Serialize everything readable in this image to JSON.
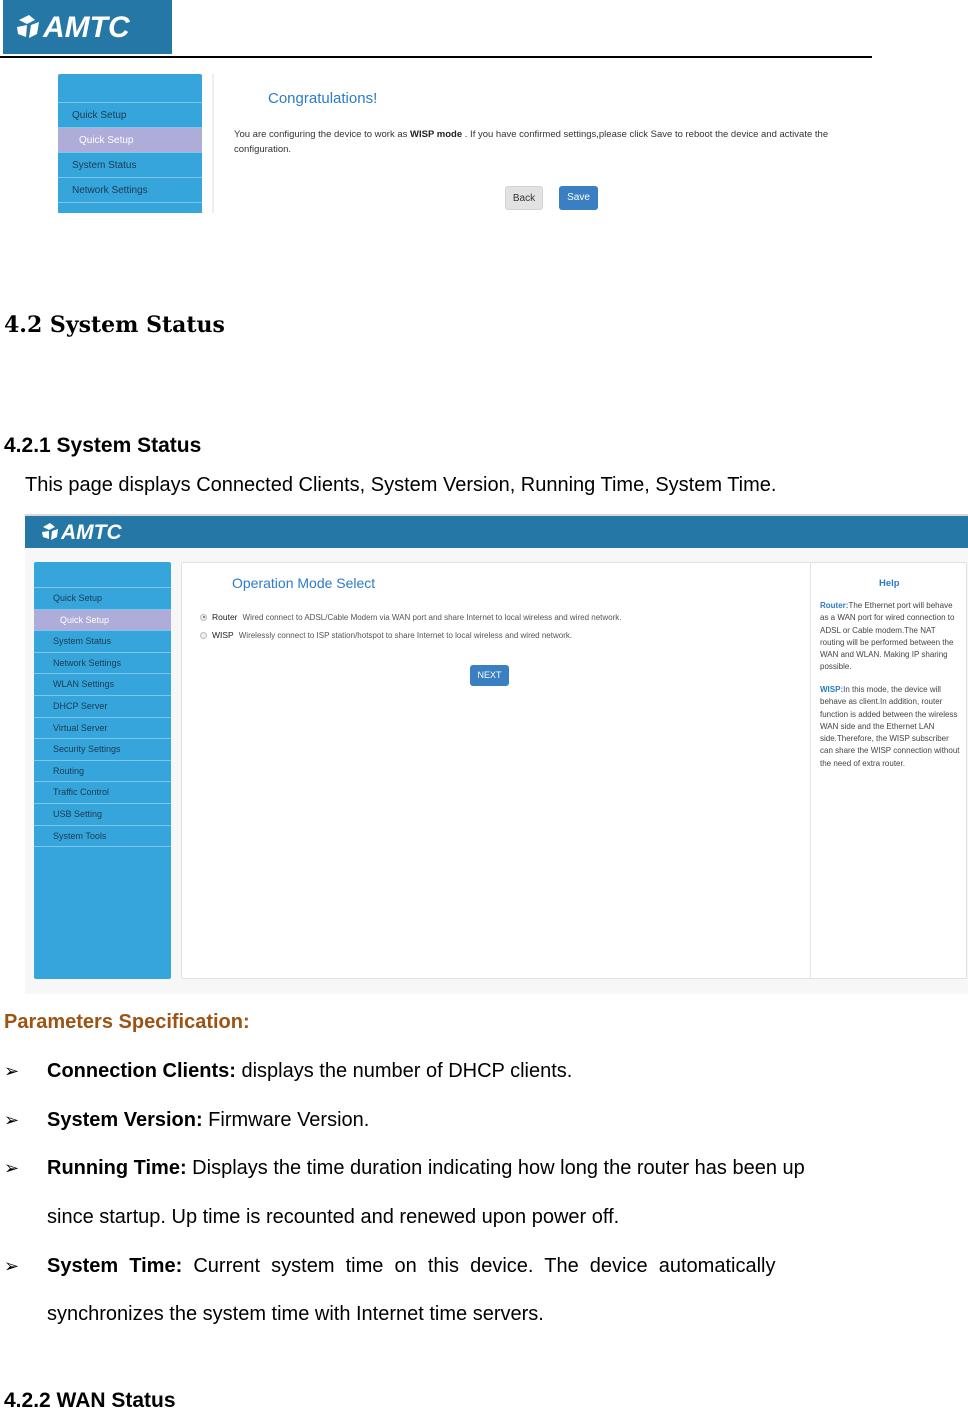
{
  "document": {
    "logo_text": "AMTC",
    "heading_main": "4.2 System Status",
    "heading_sub": "4.2.1 System Status",
    "intro": "This page displays Connected Clients, System Version, Running Time, System Time.",
    "params_title": "Parameters Specification:",
    "params": [
      {
        "label": "Connection Clients:",
        "text": " displays the number of DHCP clients."
      },
      {
        "label": "System Version:",
        "text": " Firmware Version."
      },
      {
        "label": "Running Time:",
        "text": " Displays the time duration indicating how long the router has been up",
        "continuation": "since startup. Up time is recounted and renewed upon power off."
      },
      {
        "label": "System  Time:",
        "text": "  Current  system  time  on  this  device.  The  device  automatically",
        "continuation": "synchronizes the system time with Internet time servers."
      }
    ],
    "bullet_glyph": "➢",
    "next_heading": "4.2.2 WAN Status"
  },
  "screenshot1": {
    "nav": [
      "Quick Setup",
      "Quick Setup",
      "System Status",
      "Network Settings"
    ],
    "title": "Congratulations!",
    "message_pre": "You are configuring the device to work as ",
    "message_bold": "WISP mode",
    "message_post": " . If you have confirmed settings,please click Save to reboot the device and activate the configuration.",
    "back_label": "Back",
    "save_label": "Save"
  },
  "screenshot2": {
    "logo_text": "AMTC",
    "nav": [
      "Quick Setup",
      "Quick Setup",
      "System Status",
      "Network Settings",
      "WLAN Settings",
      "DHCP Server",
      "Virtual Server",
      "Security Settings",
      "Routing",
      "Traffic Control",
      "USB Setting",
      "System Tools"
    ],
    "title": "Operation Mode Select",
    "options": [
      {
        "label": "Router",
        "desc": "Wired connect to ADSL/Cable Modem via WAN port and share Internet to local wireless and wired network.",
        "checked": true
      },
      {
        "label": "WISP",
        "desc": "Wirelessly connect to ISP station/hotspot to share Internet to local wireless and wired network.",
        "checked": false
      }
    ],
    "next_label": "NEXT",
    "help_title": "Help",
    "help_router_label": "Router:",
    "help_router_text": "The Ethernet port will behave as a WAN port for wired connection to ADSL or Cable modem.The NAT routing will be performed between the WAN and WLAN. Making IP sharing possible.",
    "help_wisp_label": "WISP:",
    "help_wisp_text": "In this mode, the device will behave as client.In addition, router function is added between the wireless WAN side and the Ethernet LAN side.Therefore, the WISP subscriber can share the WISP connection without the need of extra router."
  },
  "colors": {
    "brand_blue": "#2577a6",
    "sidebar_blue": "#35a5dc",
    "active_nav": "#aeacd9",
    "title_blue": "#2c7bc8",
    "button_blue": "#3a7fc1",
    "params_title": "#9c5313"
  }
}
